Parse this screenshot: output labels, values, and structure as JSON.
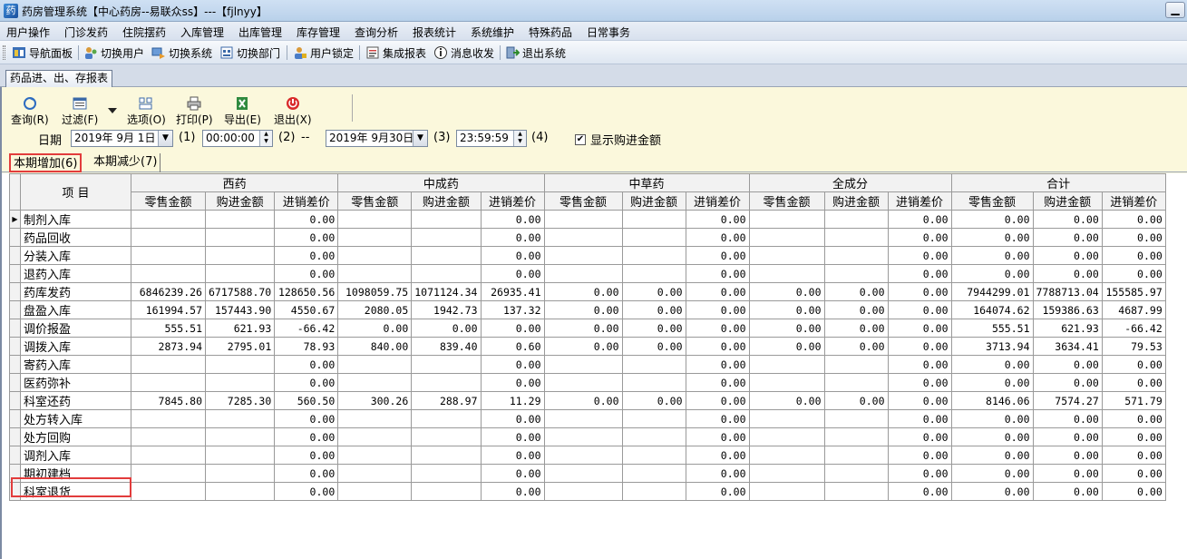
{
  "window": {
    "title": "药房管理系统【中心药房--易联众ss】---【fjlnyy】",
    "minimize_glyph": "▁"
  },
  "menu": [
    "用户操作",
    "门诊发药",
    "住院摆药",
    "入库管理",
    "出库管理",
    "库存管理",
    "查询分析",
    "报表统计",
    "系统维护",
    "特殊药品",
    "日常事务"
  ],
  "toolbar": [
    {
      "label": "导航面板",
      "icon": "nav-panel-icon"
    },
    {
      "label": "切换用户",
      "icon": "switch-user-icon"
    },
    {
      "label": "切换系统",
      "icon": "switch-system-icon"
    },
    {
      "label": "切换部门",
      "icon": "switch-dept-icon"
    },
    {
      "label": "用户锁定",
      "icon": "lock-user-icon"
    },
    {
      "label": "集成报表",
      "icon": "report-icon"
    },
    {
      "label": "消息收发",
      "icon": "message-icon"
    },
    {
      "label": "退出系统",
      "icon": "exit-icon"
    }
  ],
  "doc_tab": "药品进、出、存报表",
  "actions": [
    {
      "label": "查询(R)",
      "icon": "query-icon"
    },
    {
      "label": "过滤(F)",
      "icon": "filter-icon"
    },
    {
      "label": "选项(O)",
      "icon": "options-icon"
    },
    {
      "label": "打印(P)",
      "icon": "print-icon"
    },
    {
      "label": "导出(E)",
      "icon": "export-excel-icon"
    },
    {
      "label": "退出(X)",
      "icon": "exit-power-icon"
    }
  ],
  "filter": {
    "date_label": "日期",
    "start_date": "2019年 9月 1日",
    "start_hotkey": "(1)",
    "start_time": "00:00:00",
    "start_time_hotkey": "(2)",
    "range_sep": "--",
    "end_date": "2019年 9月30日",
    "end_hotkey": "(3)",
    "end_time": "23:59:59",
    "end_time_hotkey": "(4)",
    "show_purchase_label": "显示购进金额",
    "show_purchase_checked": true
  },
  "subtabs": {
    "increase": "本期增加(6)",
    "decrease": "本期减少(7)"
  },
  "grid": {
    "item_header": "项  目",
    "groups": [
      "西药",
      "中成药",
      "中草药",
      "全成分",
      "合计"
    ],
    "subcols": [
      "零售金额",
      "购进金额",
      "进销差价"
    ],
    "rows": [
      {
        "name": "制剂入库",
        "v": [
          "",
          "",
          "0.00",
          "",
          "",
          "0.00",
          "",
          "",
          "0.00",
          "",
          "",
          "0.00",
          "0.00",
          "0.00",
          "0.00"
        ]
      },
      {
        "name": "药品回收",
        "v": [
          "",
          "",
          "0.00",
          "",
          "",
          "0.00",
          "",
          "",
          "0.00",
          "",
          "",
          "0.00",
          "0.00",
          "0.00",
          "0.00"
        ]
      },
      {
        "name": "分装入库",
        "v": [
          "",
          "",
          "0.00",
          "",
          "",
          "0.00",
          "",
          "",
          "0.00",
          "",
          "",
          "0.00",
          "0.00",
          "0.00",
          "0.00"
        ]
      },
      {
        "name": "退药入库",
        "v": [
          "",
          "",
          "0.00",
          "",
          "",
          "0.00",
          "",
          "",
          "0.00",
          "",
          "",
          "0.00",
          "0.00",
          "0.00",
          "0.00"
        ]
      },
      {
        "name": "药库发药",
        "v": [
          "6846239.26",
          "6717588.70",
          "128650.56",
          "1098059.75",
          "1071124.34",
          "26935.41",
          "0.00",
          "0.00",
          "0.00",
          "0.00",
          "0.00",
          "0.00",
          "7944299.01",
          "7788713.04",
          "155585.97"
        ]
      },
      {
        "name": "盘盈入库",
        "v": [
          "161994.57",
          "157443.90",
          "4550.67",
          "2080.05",
          "1942.73",
          "137.32",
          "0.00",
          "0.00",
          "0.00",
          "0.00",
          "0.00",
          "0.00",
          "164074.62",
          "159386.63",
          "4687.99"
        ]
      },
      {
        "name": "调价报盈",
        "v": [
          "555.51",
          "621.93",
          "-66.42",
          "0.00",
          "0.00",
          "0.00",
          "0.00",
          "0.00",
          "0.00",
          "0.00",
          "0.00",
          "0.00",
          "555.51",
          "621.93",
          "-66.42"
        ]
      },
      {
        "name": "调拨入库",
        "v": [
          "2873.94",
          "2795.01",
          "78.93",
          "840.00",
          "839.40",
          "0.60",
          "0.00",
          "0.00",
          "0.00",
          "0.00",
          "0.00",
          "0.00",
          "3713.94",
          "3634.41",
          "79.53"
        ]
      },
      {
        "name": "寄药入库",
        "v": [
          "",
          "",
          "0.00",
          "",
          "",
          "0.00",
          "",
          "",
          "0.00",
          "",
          "",
          "0.00",
          "0.00",
          "0.00",
          "0.00"
        ]
      },
      {
        "name": "医药弥补",
        "v": [
          "",
          "",
          "0.00",
          "",
          "",
          "0.00",
          "",
          "",
          "0.00",
          "",
          "",
          "0.00",
          "0.00",
          "0.00",
          "0.00"
        ]
      },
      {
        "name": "科室还药",
        "v": [
          "7845.80",
          "7285.30",
          "560.50",
          "300.26",
          "288.97",
          "11.29",
          "0.00",
          "0.00",
          "0.00",
          "0.00",
          "0.00",
          "0.00",
          "8146.06",
          "7574.27",
          "571.79"
        ]
      },
      {
        "name": "处方转入库",
        "v": [
          "",
          "",
          "0.00",
          "",
          "",
          "0.00",
          "",
          "",
          "0.00",
          "",
          "",
          "0.00",
          "0.00",
          "0.00",
          "0.00"
        ]
      },
      {
        "name": "处方回购",
        "v": [
          "",
          "",
          "0.00",
          "",
          "",
          "0.00",
          "",
          "",
          "0.00",
          "",
          "",
          "0.00",
          "0.00",
          "0.00",
          "0.00"
        ]
      },
      {
        "name": "调剂入库",
        "v": [
          "",
          "",
          "0.00",
          "",
          "",
          "0.00",
          "",
          "",
          "0.00",
          "",
          "",
          "0.00",
          "0.00",
          "0.00",
          "0.00"
        ]
      },
      {
        "name": "期初建档",
        "v": [
          "",
          "",
          "0.00",
          "",
          "",
          "0.00",
          "",
          "",
          "0.00",
          "",
          "",
          "0.00",
          "0.00",
          "0.00",
          "0.00"
        ]
      },
      {
        "name": "科室退货",
        "v": [
          "",
          "",
          "0.00",
          "",
          "",
          "0.00",
          "",
          "",
          "0.00",
          "",
          "",
          "0.00",
          "0.00",
          "0.00",
          "0.00"
        ]
      }
    ],
    "current_row_marker": "▶"
  },
  "colors": {
    "panel_bg": "#fbf8dc",
    "highlight_red": "#e23c3c",
    "menu_bg": "#dfe6f0"
  }
}
